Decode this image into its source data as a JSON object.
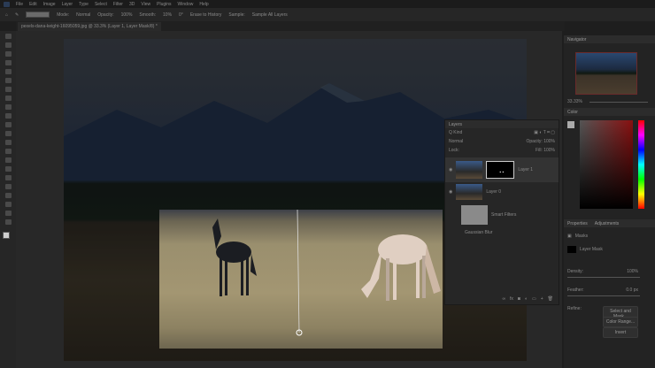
{
  "menu": [
    "File",
    "Edit",
    "Image",
    "Layer",
    "Type",
    "Select",
    "Filter",
    "3D",
    "View",
    "Plugins",
    "Window",
    "Help"
  ],
  "options": {
    "mode_label": "Mode:",
    "mode_value": "Normal",
    "opacity_label": "Opacity:",
    "opacity_value": "100%",
    "flow_label": "Smooth:",
    "flow_value": "10%",
    "angle": "0°",
    "erase_label": "Erase to History",
    "sample_label": "Sample:",
    "sample_value": "Sample All Layers"
  },
  "document_tab": "pexels-dana-keight-16095059.jpg @ 33.3% (Layer 1, Layer Mask/8) *",
  "layers_panel": {
    "title": "Layers",
    "kind": "Q Kind",
    "blend": "Normal",
    "opacity": "Opacity: 100%",
    "lock": "Lock:",
    "fill": "Fill: 100%",
    "layers": [
      {
        "name": "Layer 1"
      },
      {
        "name": "Layer 0"
      },
      {
        "name": "Smart Filters"
      },
      {
        "name": "Gaussian Blur"
      }
    ]
  },
  "navigator": {
    "title": "Navigator",
    "zoom": "33.33%"
  },
  "color": {
    "title": "Color"
  },
  "properties": {
    "title": "Properties",
    "tab2": "Adjustments",
    "masks": "Masks",
    "layer_mask": "Layer Mask",
    "density_label": "Density:",
    "density_value": "100%",
    "feather_label": "Feather:",
    "feather_value": "0.0 px",
    "refine_label": "Refine:",
    "select_mask": "Select and Mask...",
    "color_range": "Color Range...",
    "invert": "Invert"
  }
}
